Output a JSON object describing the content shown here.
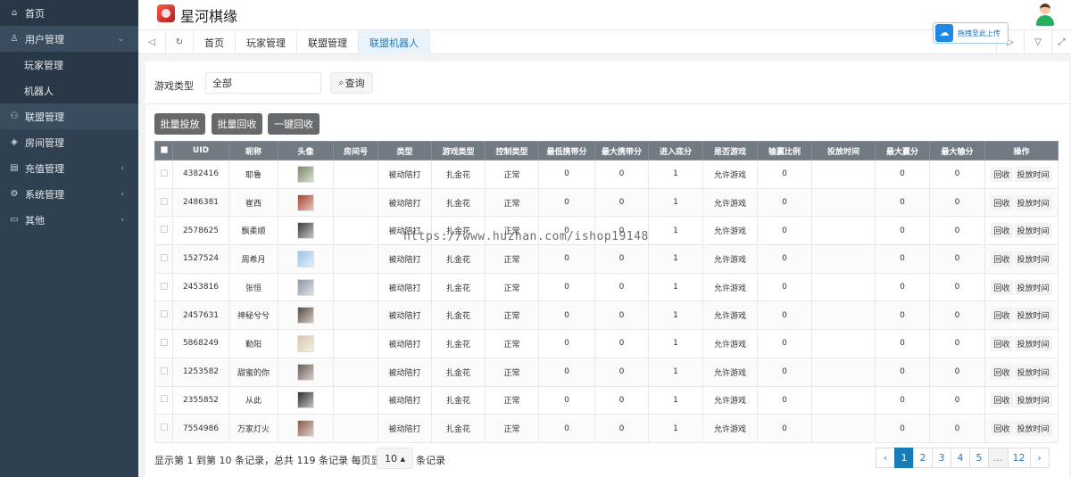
{
  "sidebar": {
    "items": [
      {
        "label": "首页",
        "icon": "home-icon",
        "glyph": "⌂"
      },
      {
        "label": "用户管理",
        "icon": "users-icon",
        "glyph": "♙",
        "caret": "⌄"
      },
      {
        "label": "玩家管理"
      },
      {
        "label": "机器人"
      },
      {
        "label": "联盟管理",
        "icon": "group-icon",
        "glyph": "⚇"
      },
      {
        "label": "房间管理",
        "icon": "room-icon",
        "glyph": "◈"
      },
      {
        "label": "充值管理",
        "icon": "wallet-icon",
        "glyph": "▤",
        "caret": "‹"
      },
      {
        "label": "系统管理",
        "icon": "gear-icon",
        "glyph": "⚙",
        "caret": "‹"
      },
      {
        "label": "其他",
        "icon": "folder-icon",
        "glyph": "▭",
        "caret": "‹"
      }
    ]
  },
  "header": {
    "title": "星河棋缘"
  },
  "upload": {
    "label": "拖拽至此上传"
  },
  "tabs": {
    "prev": "◁",
    "refresh": "↻",
    "next": "▷",
    "menu": "▽",
    "full": "⤢",
    "items": [
      "首页",
      "玩家管理",
      "联盟管理",
      "联盟机器人"
    ]
  },
  "filter": {
    "label": "游戏类型",
    "value": "全部",
    "query": "查询"
  },
  "actions": {
    "batch_put": "批量投放",
    "batch_recall": "批量回收",
    "one_click_recall": "一键回收"
  },
  "table": {
    "headers": [
      "UID",
      "昵称",
      "头像",
      "房间号",
      "类型",
      "游戏类型",
      "控制类型",
      "最低携带分",
      "最大携带分",
      "进入底分",
      "是否游戏",
      "输赢比例",
      "投放时间",
      "最大赢分",
      "最大输分",
      "操作"
    ],
    "ops": [
      "回收",
      "投放时间"
    ],
    "rows": [
      {
        "uid": "4382416",
        "nick": "耶鲁",
        "room": "",
        "type": "被动陪打",
        "game": "扎金花",
        "ctrl": "正常",
        "min": "0",
        "max": "0",
        "base": "1",
        "play": "允许游戏",
        "ratio": "0",
        "time": "",
        "win": "0",
        "lose": "0",
        "color": "#7b8a6a"
      },
      {
        "uid": "2486381",
        "nick": "崔西",
        "room": "",
        "type": "被动陪打",
        "game": "扎金花",
        "ctrl": "正常",
        "min": "0",
        "max": "0",
        "base": "1",
        "play": "允许游戏",
        "ratio": "0",
        "time": "",
        "win": "0",
        "lose": "0",
        "color": "#a4432c"
      },
      {
        "uid": "2578625",
        "nick": "飘柔顺",
        "room": "",
        "type": "被动陪打",
        "game": "扎金花",
        "ctrl": "正常",
        "min": "0",
        "max": "0",
        "base": "1",
        "play": "允许游戏",
        "ratio": "0",
        "time": "",
        "win": "0",
        "lose": "0",
        "color": "#3a3a3a"
      },
      {
        "uid": "1527524",
        "nick": "周希月",
        "room": "",
        "type": "被动陪打",
        "game": "扎金花",
        "ctrl": "正常",
        "min": "0",
        "max": "0",
        "base": "1",
        "play": "允许游戏",
        "ratio": "0",
        "time": "",
        "win": "0",
        "lose": "0",
        "color": "#9cc4e4"
      },
      {
        "uid": "2453816",
        "nick": "张恒",
        "room": "",
        "type": "被动陪打",
        "game": "扎金花",
        "ctrl": "正常",
        "min": "0",
        "max": "0",
        "base": "1",
        "play": "允许游戏",
        "ratio": "0",
        "time": "",
        "win": "0",
        "lose": "0",
        "color": "#8a97a6"
      },
      {
        "uid": "2457631",
        "nick": "神秘兮兮",
        "room": "",
        "type": "被动陪打",
        "game": "扎金花",
        "ctrl": "正常",
        "min": "0",
        "max": "0",
        "base": "1",
        "play": "允许游戏",
        "ratio": "0",
        "time": "",
        "win": "0",
        "lose": "0",
        "color": "#5b4a3a"
      },
      {
        "uid": "5868249",
        "nick": "勤阳",
        "room": "",
        "type": "被动陪打",
        "game": "扎金花",
        "ctrl": "正常",
        "min": "0",
        "max": "0",
        "base": "1",
        "play": "允许游戏",
        "ratio": "0",
        "time": "",
        "win": "0",
        "lose": "0",
        "color": "#d9c6a8"
      },
      {
        "uid": "1253582",
        "nick": "甜蜜的你",
        "room": "",
        "type": "被动陪打",
        "game": "扎金花",
        "ctrl": "正常",
        "min": "0",
        "max": "0",
        "base": "1",
        "play": "允许游戏",
        "ratio": "0",
        "time": "",
        "win": "0",
        "lose": "0",
        "color": "#6e5a52"
      },
      {
        "uid": "2355852",
        "nick": "从此",
        "room": "",
        "type": "被动陪打",
        "game": "扎金花",
        "ctrl": "正常",
        "min": "0",
        "max": "0",
        "base": "1",
        "play": "允许游戏",
        "ratio": "0",
        "time": "",
        "win": "0",
        "lose": "0",
        "color": "#2e2e2e"
      },
      {
        "uid": "7554986",
        "nick": "万家灯火",
        "room": "",
        "type": "被动陪打",
        "game": "扎金花",
        "ctrl": "正常",
        "min": "0",
        "max": "0",
        "base": "1",
        "play": "允许游戏",
        "ratio": "0",
        "time": "",
        "win": "0",
        "lose": "0",
        "color": "#8a5a48"
      }
    ]
  },
  "footer": {
    "summary": "显示第 1 到第 10 条记录，总共 119 条记录  每页显示",
    "page_size": "10 ▴",
    "suffix": "条记录"
  },
  "pagination": {
    "prev": "‹",
    "next": "›",
    "pages": [
      "1",
      "2",
      "3",
      "4",
      "5",
      "...",
      "12"
    ],
    "current": "1"
  },
  "watermark": "https://www.huzhan.com/ishop19148"
}
